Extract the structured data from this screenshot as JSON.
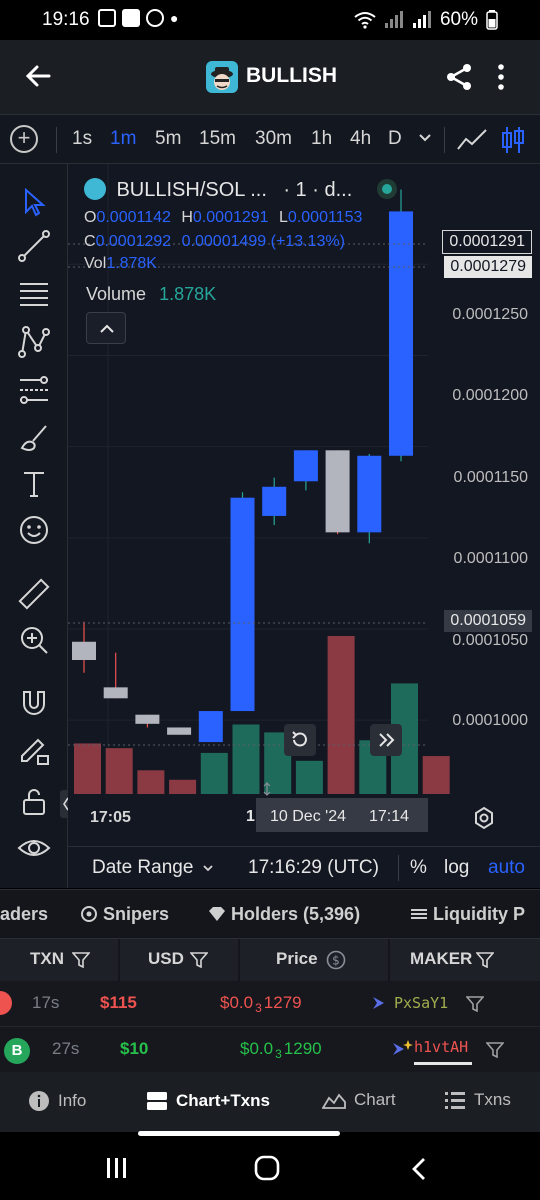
{
  "status_bar": {
    "time": "19:16",
    "battery": "60%"
  },
  "header": {
    "title": "BULLISH"
  },
  "timeframes": {
    "items": [
      "1s",
      "1m",
      "5m",
      "15m",
      "30m",
      "1h",
      "4h",
      "D"
    ],
    "active": "1m"
  },
  "chart": {
    "symbol": "BULLISH/SOL ...",
    "interval_suffix": "· 1 · d...",
    "ohlc": {
      "o_label": "O",
      "o_value": "0.0001142",
      "h_label": "H",
      "h_value": "0.0001291",
      "l_label": "L",
      "l_value": "0.0001153",
      "c_label": "C",
      "c_value": "0.0001292",
      "change": "0.00001499 (+13.13%)"
    },
    "vol_label": "Vol",
    "vol_value": "1.878K",
    "volume_label": "Volume",
    "volume_value": "1.878K",
    "price_axis": [
      "0.0001250",
      "0.0001200",
      "0.0001150",
      "0.0001100",
      "0.0001050",
      "0.0001000"
    ],
    "price_tags": {
      "high": "0.0001291",
      "last": "0.0001279",
      "cursor": "0.0001059"
    },
    "time_axis": {
      "left": "17:05",
      "cursor_prefix": "1",
      "cursor_date": "10 Dec '24",
      "cursor_time": "17:14"
    },
    "date_range_label": "Date Range",
    "clock": "17:16:29 (UTC)",
    "percent_label": "%",
    "log_label": "log",
    "auto_label": "auto"
  },
  "chart_data": {
    "type": "candlestick",
    "y_range": [
      9.65e-05,
      0.0001305
    ],
    "candles": [
      {
        "o": 0.0001043,
        "h": 0.0001054,
        "l": 0.0001026,
        "c": 0.0001033,
        "dir": "down"
      },
      {
        "o": 0.0001018,
        "h": 0.0001037,
        "l": 0.0001012,
        "c": 0.0001012,
        "dir": "down"
      },
      {
        "o": 0.0001003,
        "h": 0.0001003,
        "l": 9.96e-05,
        "c": 9.98e-05,
        "dir": "down"
      },
      {
        "o": 9.96e-05,
        "h": 9.96e-05,
        "l": 9.92e-05,
        "c": 9.92e-05,
        "dir": "down"
      },
      {
        "o": 9.88e-05,
        "h": 0.0001005,
        "l": 9.88e-05,
        "c": 0.0001005,
        "dir": "up"
      },
      {
        "o": 0.0001005,
        "h": 0.0001125,
        "l": 0.0001005,
        "c": 0.0001122,
        "dir": "up"
      },
      {
        "o": 0.0001112,
        "h": 0.0001133,
        "l": 0.0001107,
        "c": 0.0001128,
        "dir": "up"
      },
      {
        "o": 0.0001131,
        "h": 0.0001148,
        "l": 0.0001126,
        "c": 0.0001148,
        "dir": "up"
      },
      {
        "o": 0.0001148,
        "h": 0.0001148,
        "l": 0.0001102,
        "c": 0.0001103,
        "dir": "down"
      },
      {
        "o": 0.0001103,
        "h": 0.0001146,
        "l": 0.0001097,
        "c": 0.0001145,
        "dir": "up"
      },
      {
        "o": 0.0001145,
        "h": 0.0001291,
        "l": 0.0001142,
        "c": 0.0001279,
        "dir": "up"
      }
    ],
    "volume": [
      {
        "v": 0.32,
        "dir": "down"
      },
      {
        "v": 0.29,
        "dir": "down"
      },
      {
        "v": 0.15,
        "dir": "down"
      },
      {
        "v": 0.09,
        "dir": "down"
      },
      {
        "v": 0.26,
        "dir": "up"
      },
      {
        "v": 0.44,
        "dir": "up"
      },
      {
        "v": 0.39,
        "dir": "up"
      },
      {
        "v": 0.21,
        "dir": "up"
      },
      {
        "v": 1.0,
        "dir": "down"
      },
      {
        "v": 0.34,
        "dir": "up"
      },
      {
        "v": 0.7,
        "dir": "up"
      },
      {
        "v": 0.24,
        "dir": "down"
      }
    ]
  },
  "tabs": {
    "traders": "aders",
    "snipers": "Snipers",
    "holders": "Holders (5,396)",
    "liquidity": "Liquidity P"
  },
  "table": {
    "headers": {
      "txn": "TXN",
      "usd": "USD",
      "price": "Price",
      "maker": "MAKER"
    },
    "rows": [
      {
        "type": "S",
        "age": "17s",
        "usd": "$115",
        "price_prefix": "$0.0",
        "price_sub": "3",
        "price_rest": "1279",
        "maker": "PxSaY1"
      },
      {
        "type": "B",
        "age": "27s",
        "usd": "$10",
        "price_prefix": "$0.0",
        "price_sub": "3",
        "price_rest": "1290",
        "maker": "h1vtAH"
      }
    ]
  },
  "bottom_nav": {
    "info": "Info",
    "chart_txns": "Chart+Txns",
    "chart": "Chart",
    "txns": "Txns"
  },
  "colors": {
    "up": "#2962ff",
    "down": "#b2b5be",
    "vol_up": "#1e6b5c",
    "vol_down": "#8b3a44",
    "sell": "#ef5350",
    "buy": "#26a65b"
  }
}
